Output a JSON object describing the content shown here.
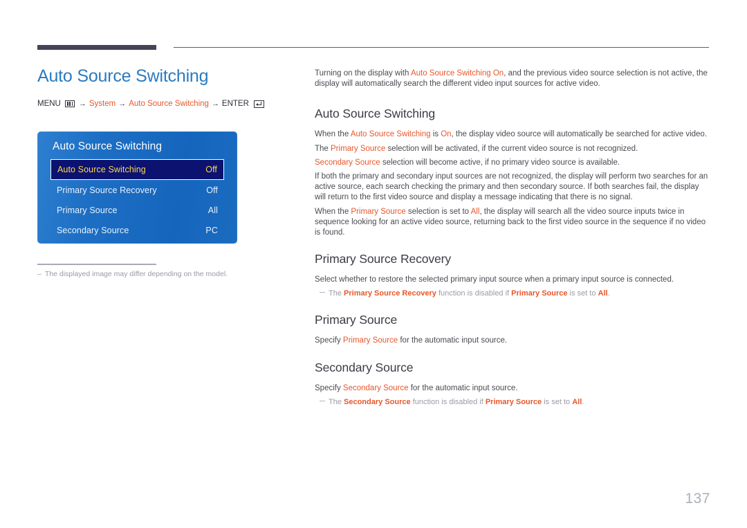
{
  "page": {
    "title": "Auto Source Switching",
    "number": "137"
  },
  "breadcrumb": {
    "menu_label": "MENU",
    "menu_icon": "menu-grid-icon",
    "arrow": "→",
    "item1": "System",
    "item2": "Auto Source Switching",
    "enter_label": "ENTER",
    "enter_icon": "enter-return-icon"
  },
  "osd": {
    "header": "Auto Source Switching",
    "rows": [
      {
        "label": "Auto Source Switching",
        "value": "Off",
        "selected": true
      },
      {
        "label": "Primary Source Recovery",
        "value": "Off",
        "selected": false
      },
      {
        "label": "Primary Source",
        "value": "All",
        "selected": false
      },
      {
        "label": "Secondary Source",
        "value": "PC",
        "selected": false
      }
    ]
  },
  "left_footnote": {
    "dash": "–",
    "text": "The displayed image may differ depending on the model."
  },
  "content": {
    "intro": {
      "p1_a": "Turning on the display with ",
      "p1_accent": "Auto Source Switching On",
      "p1_b": ", and the previous video source selection is not active, the display will automatically search the different video input sources for active video."
    },
    "sections": [
      {
        "heading": "Auto Source Switching",
        "paras": [
          {
            "a": "When the ",
            "accent1": "Auto Source Switching",
            "b": " is ",
            "accent2": "On",
            "c": ", the display video source will automatically be searched for active video."
          },
          {
            "a": "The ",
            "accent1": "Primary Source",
            "b": " selection will be activated, if the current video source is not recognized."
          },
          {
            "accent1": "Secondary Source",
            "b": " selection will become active, if no primary video source is available."
          },
          {
            "a": "If both the primary and secondary input sources are not recognized, the display will perform two searches for an active source, each search checking the primary and then secondary source. If both searches fail, the display will return to the first video source and display a message indicating that there is no signal."
          },
          {
            "a": "When the ",
            "accent1": "Primary Source",
            "b": " selection is set to ",
            "accent2": "All",
            "c": ", the display will search all the video source inputs twice in sequence looking for an active video source, returning back to the first video source in the sequence if no video is found."
          }
        ]
      },
      {
        "heading": "Primary Source Recovery",
        "para": "Select whether to restore the selected primary input source when a primary input source is connected.",
        "note": {
          "a": "The ",
          "accent1": "Primary Source Recovery",
          "b": " function is disabled if ",
          "accent2": "Primary Source",
          "c": " is set to ",
          "accent3": "All",
          "d": "."
        }
      },
      {
        "heading": "Primary Source",
        "para_a": "Specify ",
        "para_accent": "Primary Source",
        "para_b": " for the automatic input source."
      },
      {
        "heading": "Secondary Source",
        "para_a": "Specify ",
        "para_accent": "Secondary Source",
        "para_b": " for the automatic input source.",
        "note": {
          "a": "The ",
          "accent1": "Secondary Source",
          "b": " function is disabled if ",
          "accent2": "Primary Source",
          "c": " is set to ",
          "accent3": "All",
          "d": "."
        }
      }
    ]
  }
}
